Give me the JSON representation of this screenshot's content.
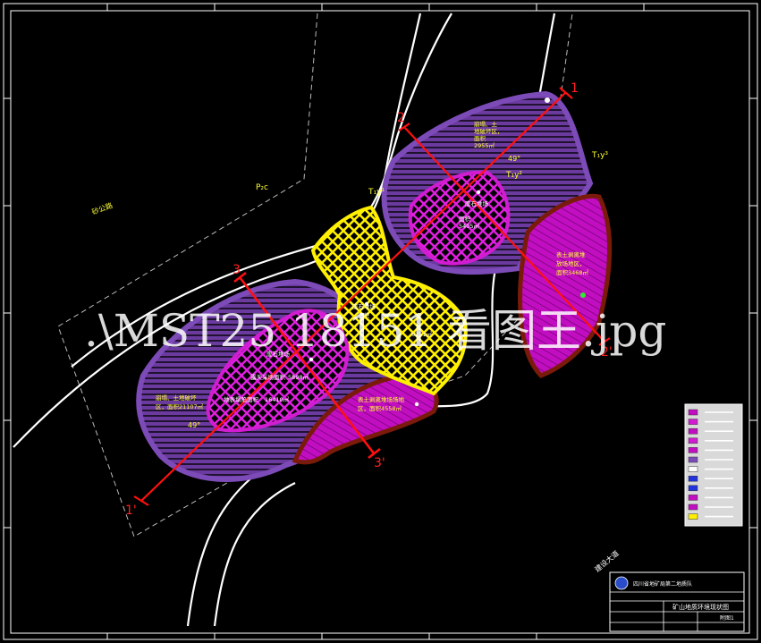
{
  "section_lines": [
    {
      "start": "1",
      "end": "1'"
    },
    {
      "start": "2",
      "end": "2'"
    },
    {
      "start": "3",
      "end": "3'"
    }
  ],
  "geology_labels": {
    "p2c": "P₂c",
    "t1y_1": "T₁y¹",
    "t1y_2": "T₁y²",
    "t1y_3": "T₁y³"
  },
  "dip_labels": [
    "49°",
    "49°"
  ],
  "zone_labels": {
    "ne_collapse": [
      "崩塌、土",
      "地破坏区，",
      "面积",
      "2955㎡"
    ],
    "ne_waste": [
      "废石堆场",
      "面积",
      "5405㎡"
    ],
    "mid_waste": [
      "废石堆场",
      "面积",
      "6251㎡"
    ],
    "sw_waste": [
      "废石堆场",
      "露天采场面积",
      "5898㎡",
      "地表塌陷面积",
      "16410㎡"
    ],
    "sw_collapse": [
      "崩塌、土地破坏",
      "区，面积21107㎡"
    ],
    "east_slope": [
      "表土剥离堆",
      "放场地区，",
      "面积3468㎡"
    ],
    "south_slope": [
      "表土剥离堆场场地",
      "区，面积4558㎡"
    ]
  },
  "road_labels": {
    "west": "砂公路",
    "southeast": "建设大道"
  },
  "watermark": ".\\MST25 18151 看图王.jpg",
  "legend": {
    "item_count": 12
  },
  "title_block": {
    "org": "四川省地矿局第二地质队",
    "drawing_title": "矿山地质环境现状图",
    "sheet_no": "附图1"
  },
  "colors": {
    "background": "#000000",
    "purple_zone": "#6b3a9e",
    "magenta_zone": "#c10ec1",
    "dark_red_border": "#7a1a0a",
    "yellow_zone": "#ffef00",
    "section_line": "#ff1010",
    "label_yellow": "#ffff33",
    "frame": "#ffffff"
  }
}
